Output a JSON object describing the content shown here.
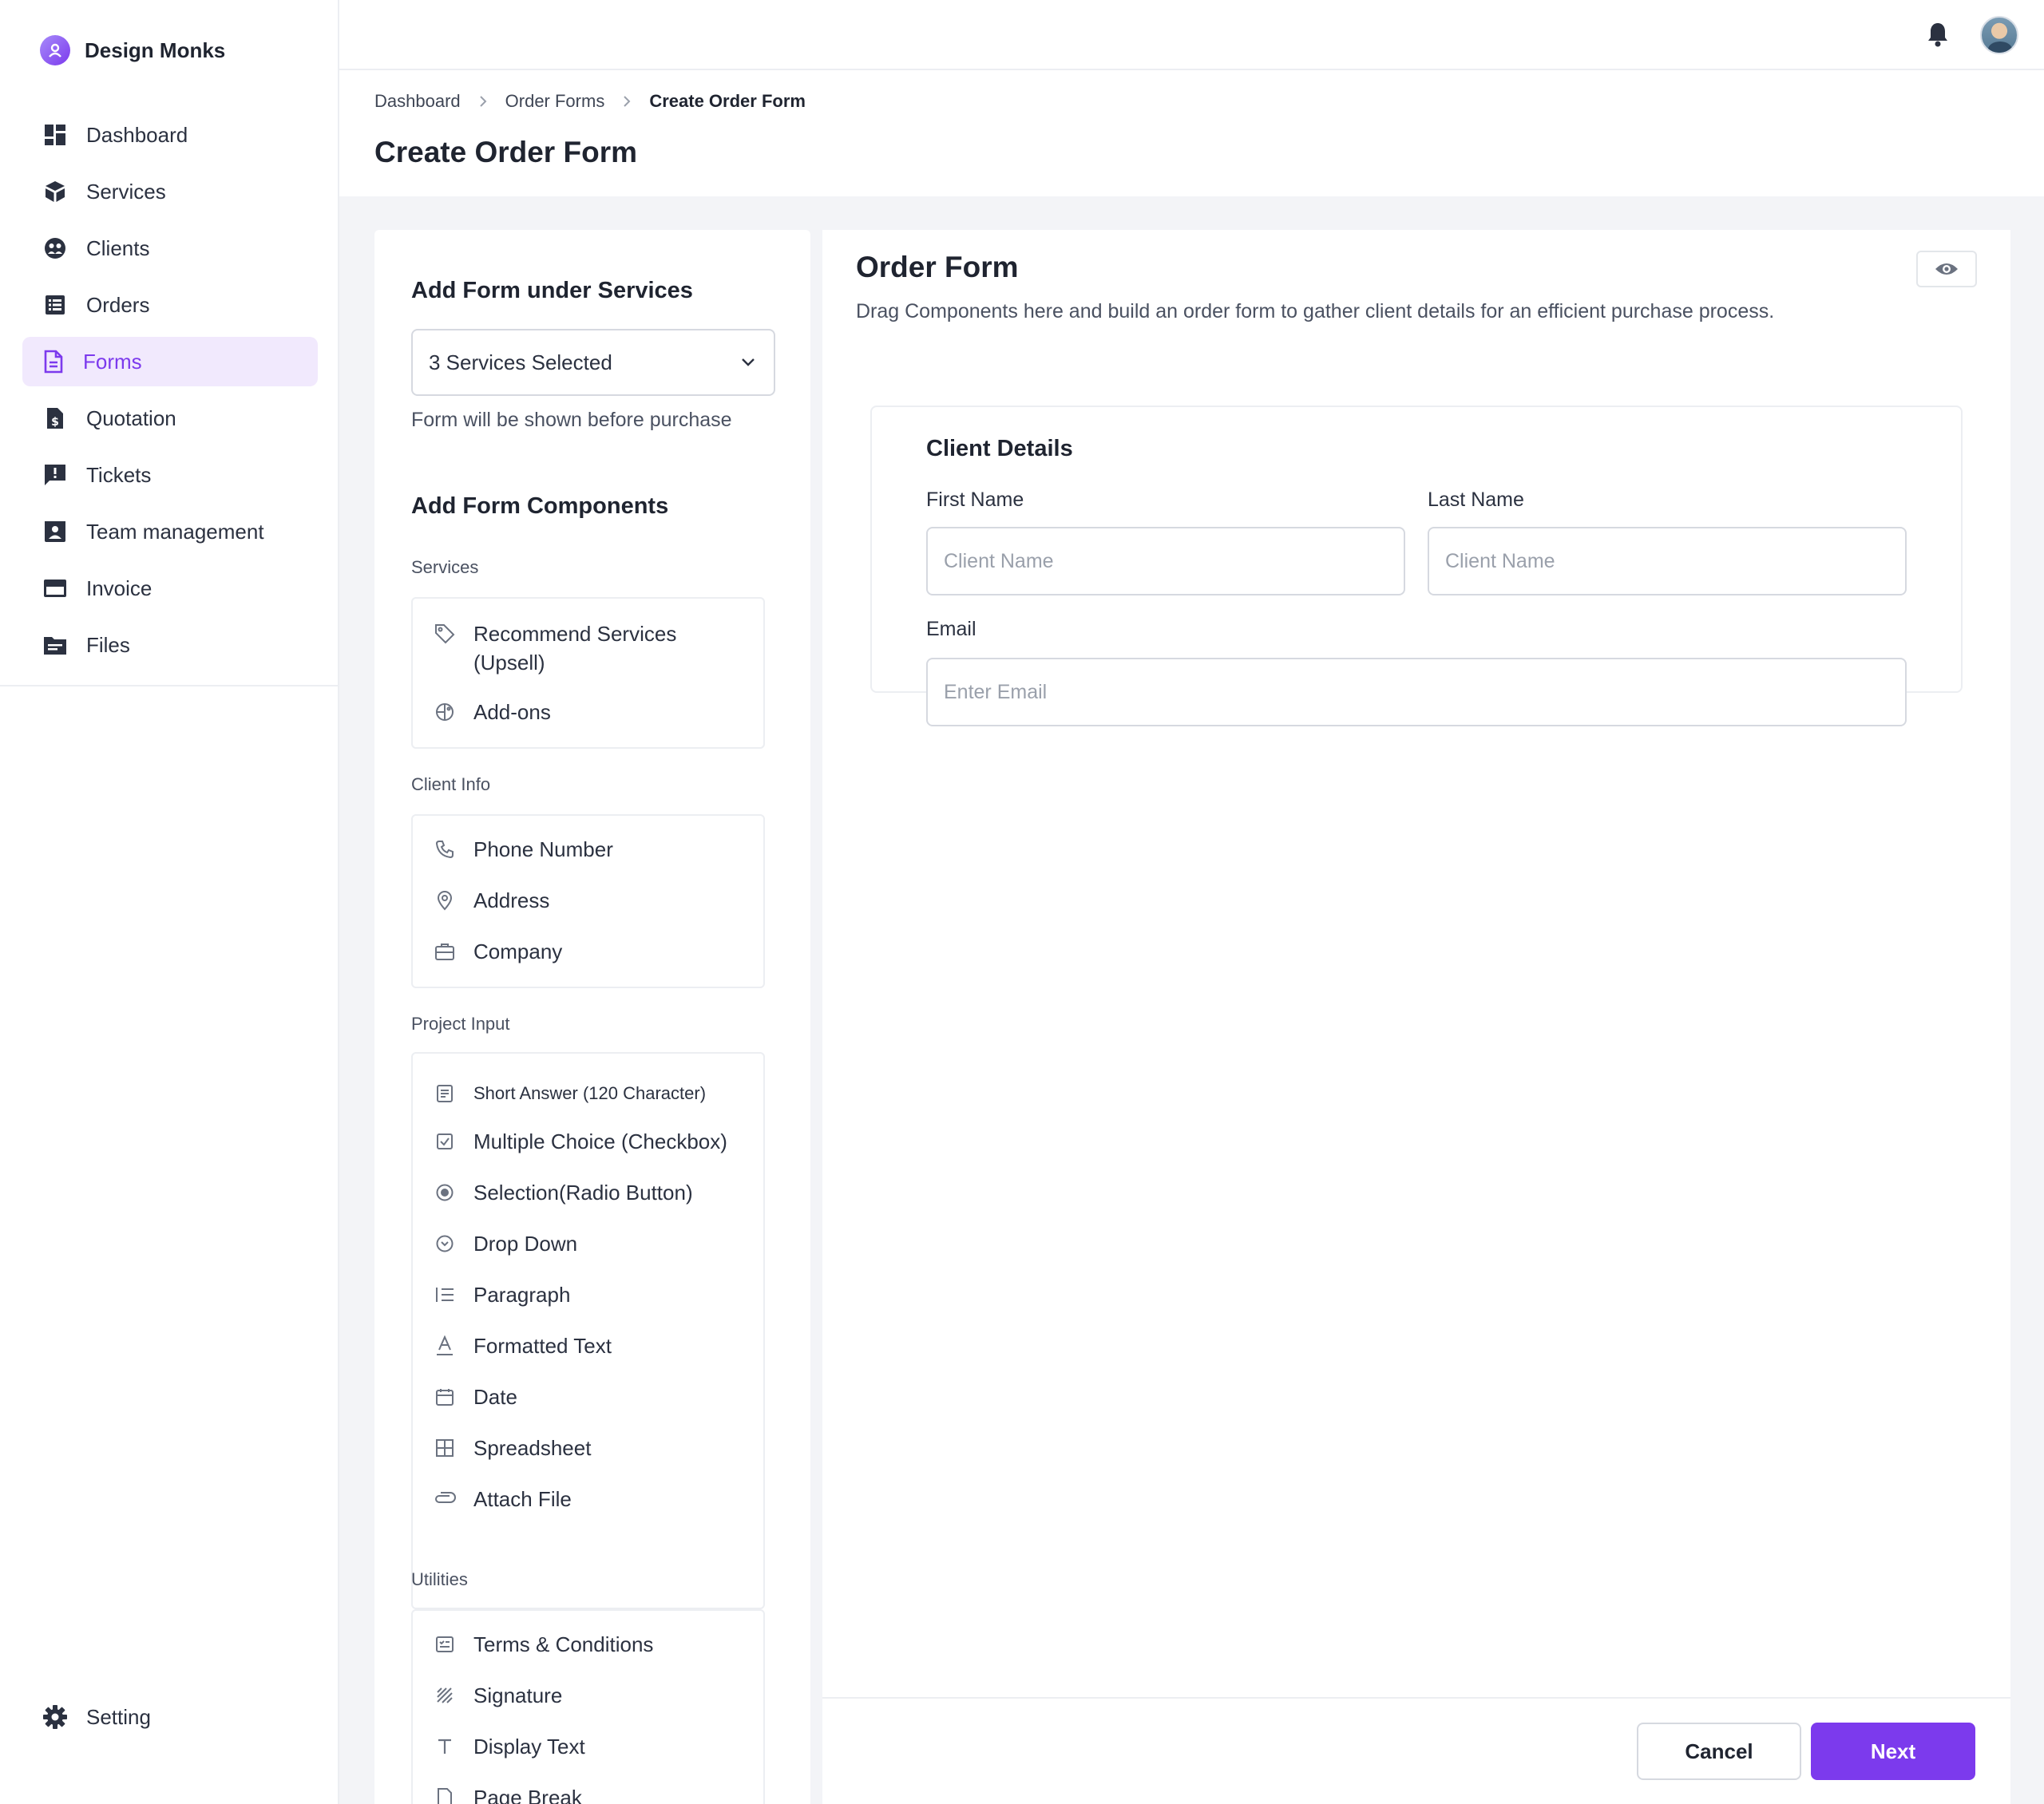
{
  "brand": {
    "name": "Design Monks"
  },
  "sidebar": {
    "items": [
      {
        "label": "Dashboard",
        "icon": "dashboard-icon"
      },
      {
        "label": "Services",
        "icon": "box-icon"
      },
      {
        "label": "Clients",
        "icon": "clients-icon"
      },
      {
        "label": "Orders",
        "icon": "orders-icon"
      },
      {
        "label": "Forms",
        "icon": "document-icon",
        "active": true
      },
      {
        "label": "Quotation",
        "icon": "quotation-icon"
      },
      {
        "label": "Tickets",
        "icon": "ticket-icon"
      },
      {
        "label": "Team management",
        "icon": "team-icon"
      },
      {
        "label": "Invoice",
        "icon": "card-icon"
      },
      {
        "label": "Files",
        "icon": "folder-icon"
      }
    ],
    "setting_label": "Setting"
  },
  "breadcrumb": {
    "items": [
      "Dashboard",
      "Order Forms",
      "Create Order Form"
    ]
  },
  "page": {
    "title": "Create Order Form"
  },
  "left_panel": {
    "heading_services": "Add Form under Services",
    "select_value": "3 Services Selected",
    "note": "Form will be shown before purchase",
    "heading_components": "Add Form Components",
    "groups": {
      "services": {
        "label": "Services",
        "items": [
          "Recommend Services (Upsell)",
          "Add-ons"
        ]
      },
      "client_info": {
        "label": "Client Info",
        "items": [
          "Phone Number",
          "Address",
          "Company"
        ]
      },
      "project_input": {
        "label": "Project Input",
        "items": [
          "Short Answer (120 Character)",
          "Multiple Choice (Checkbox)",
          "Selection(Radio Button)",
          "Drop Down",
          "Paragraph",
          "Formatted Text",
          "Date",
          "Spreadsheet",
          "Attach File"
        ]
      },
      "utilities": {
        "label": "Utilities",
        "items": [
          "Terms & Conditions",
          "Signature",
          "Display Text",
          "Page Break"
        ]
      }
    }
  },
  "right_panel": {
    "title": "Order Form",
    "description": "Drag Components here and build an order form to gather client details for an efficient purchase process.",
    "card": {
      "title": "Client Details",
      "first_name_label": "First Name",
      "first_name_placeholder": "Client Name",
      "last_name_label": "Last Name",
      "last_name_placeholder": "Client Name",
      "email_label": "Email",
      "email_placeholder": "Enter Email"
    },
    "cancel_label": "Cancel",
    "next_label": "Next"
  },
  "colors": {
    "accent": "#7c3aed",
    "active_bg": "#f1e9fd",
    "page_bg": "#f3f4f7"
  }
}
